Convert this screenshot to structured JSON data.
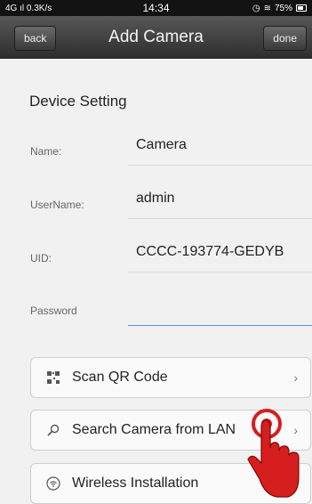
{
  "status_bar": {
    "network": "4G",
    "speed": "0.3K/s",
    "time": "14:34",
    "battery": "75%"
  },
  "nav": {
    "back_label": "back",
    "title": "Add Camera",
    "done_label": "done"
  },
  "device_setting": {
    "section_title": "Device Setting",
    "fields": [
      {
        "label": "Name:",
        "value": "Camera"
      },
      {
        "label": "UserName:",
        "value": "admin"
      },
      {
        "label": "UID:",
        "value": "CCCC-193774-GEDYB"
      },
      {
        "label": "Password",
        "value": ""
      }
    ]
  },
  "actions": [
    {
      "label": "Scan QR Code",
      "icon": "qr-code-icon"
    },
    {
      "label": "Search Camera from LAN",
      "icon": "search-icon"
    },
    {
      "label": "Wireless Installation",
      "icon": "wifi-icon"
    }
  ],
  "colors": {
    "navbar_top": "#575757",
    "navbar_bottom": "#2d2d2d",
    "hand_fill": "#d61e1e",
    "focus_line": "#5b93c9"
  }
}
